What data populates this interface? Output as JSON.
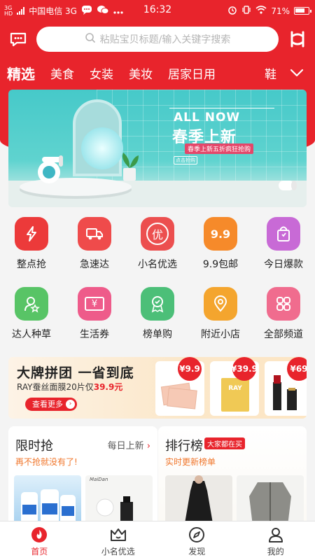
{
  "status": {
    "signal_label": "3G",
    "hd_label": "HD",
    "carrier": "中国电信 3G",
    "time": "16:32",
    "battery": "71%"
  },
  "search": {
    "placeholder": "粘贴宝贝标题/输入关键字搜索"
  },
  "tabs": [
    "精选",
    "美食",
    "女装",
    "美妆",
    "居家日用"
  ],
  "tab_partial": "鞋",
  "banner": {
    "title_en": "ALL NOW",
    "title_cn": "春季上新",
    "tag": "春季上新五折疯狂抢购",
    "small_tag": "点击抢购"
  },
  "grid_row1": [
    {
      "label": "整点抢",
      "icon": "lightning-icon",
      "color": "#ec3a3a"
    },
    {
      "label": "急速达",
      "icon": "truck-icon",
      "color": "#ef4b4b"
    },
    {
      "label": "小名优选",
      "icon": "you-badge-icon",
      "color": "#ec4f4f",
      "glyph": "优"
    },
    {
      "label": "9.9包邮",
      "icon": "nine-nine-icon",
      "color": "#f68a2a",
      "glyph": "9.9"
    },
    {
      "label": "今日爆款",
      "icon": "bag-icon",
      "color": "#c86ad6"
    }
  ],
  "grid_row2": [
    {
      "label": "达人种草",
      "icon": "influencer-icon",
      "color": "#58c466"
    },
    {
      "label": "生活券",
      "icon": "coupon-icon",
      "color": "#ee5b8a",
      "glyph": "¥"
    },
    {
      "label": "榜单购",
      "icon": "award-icon",
      "color": "#4cbf78"
    },
    {
      "label": "附近小店",
      "icon": "location-icon",
      "color": "#f4a52e"
    },
    {
      "label": "全部频道",
      "icon": "grid-icon",
      "color": "#f06c8e"
    }
  ],
  "promo": {
    "title": "大牌拼团 一省到底",
    "desc_prefix": "RAY蚕丝面膜20片仅",
    "desc_price": "39.9元",
    "button": "查看更多",
    "prices": [
      "¥9.9",
      "¥39.9",
      "¥69"
    ],
    "brand_label": "RAY"
  },
  "cards": {
    "flash": {
      "title": "限时抢",
      "more": "每日上新",
      "sub": "再不抢就没有了!",
      "thumb_brand": "MaiDan"
    },
    "rank": {
      "title": "排行榜",
      "badge": "大家都在买",
      "sub": "实时更新榜单"
    }
  },
  "tabbar": [
    {
      "label": "首页",
      "icon": "home-flame-icon",
      "active": true
    },
    {
      "label": "小名优选",
      "icon": "crown-icon"
    },
    {
      "label": "发现",
      "icon": "compass-icon"
    },
    {
      "label": "我的",
      "icon": "user-icon"
    }
  ],
  "colors": {
    "brand": "#e8242c",
    "accent": "#f0762b"
  }
}
